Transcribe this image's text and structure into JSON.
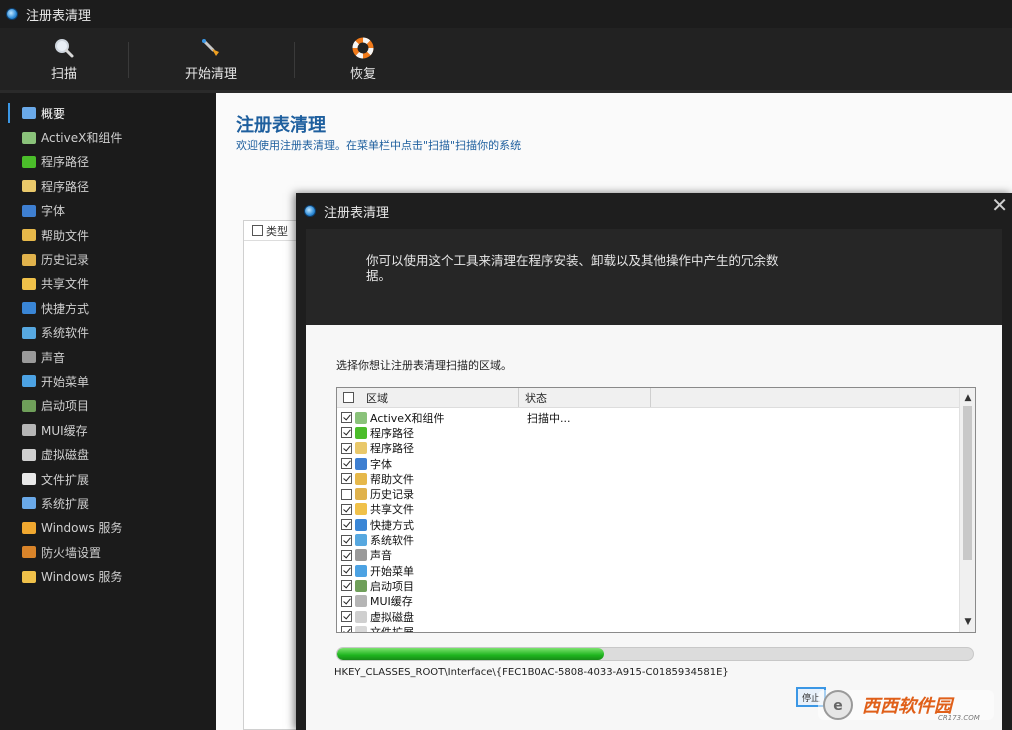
{
  "window": {
    "title": "注册表清理"
  },
  "toolbar": {
    "buttons": [
      {
        "label": "扫描",
        "icon": "magnifier-icon"
      },
      {
        "label": "开始清理",
        "icon": "broom-icon"
      },
      {
        "label": "恢复",
        "icon": "lifebuoy-icon"
      }
    ]
  },
  "sidebar": {
    "items": [
      {
        "label": "概要",
        "icon": "overview-icon",
        "color": "#6aa9e8"
      },
      {
        "label": "ActiveX和组件",
        "icon": "activex-icon",
        "color": "#8ac27a"
      },
      {
        "label": "程序路径",
        "icon": "program-path-icon",
        "color": "#4bbd2a"
      },
      {
        "label": "程序路径",
        "icon": "program-path-icon",
        "color": "#e9c86a"
      },
      {
        "label": "字体",
        "icon": "font-icon",
        "color": "#3e7fd1"
      },
      {
        "label": "帮助文件",
        "icon": "help-icon",
        "color": "#e6b84a"
      },
      {
        "label": "历史记录",
        "icon": "history-icon",
        "color": "#e0b24c"
      },
      {
        "label": "共享文件",
        "icon": "shared-folder-icon",
        "color": "#f0c14a"
      },
      {
        "label": "快捷方式",
        "icon": "shortcut-icon",
        "color": "#3a86d6"
      },
      {
        "label": "系统软件",
        "icon": "system-software-icon",
        "color": "#57a8e0"
      },
      {
        "label": "声音",
        "icon": "sound-icon",
        "color": "#9a9a9a"
      },
      {
        "label": "开始菜单",
        "icon": "start-menu-icon",
        "color": "#4ca2e3"
      },
      {
        "label": "启动项目",
        "icon": "startup-icon",
        "color": "#6f9f5a"
      },
      {
        "label": "MUI缓存",
        "icon": "mui-cache-icon",
        "color": "#b5b5b5"
      },
      {
        "label": "虚拟磁盘",
        "icon": "virtual-disk-icon",
        "color": "#cfcfcf"
      },
      {
        "label": "文件扩展",
        "icon": "file-extension-icon",
        "color": "#e8e8e8"
      },
      {
        "label": "系统扩展",
        "icon": "system-extension-icon",
        "color": "#6aa9e8"
      },
      {
        "label": "Windows 服务",
        "icon": "windows-service-icon",
        "color": "#f0a830"
      },
      {
        "label": "防火墙设置",
        "icon": "firewall-icon",
        "color": "#d9842a"
      },
      {
        "label": "Windows 服务",
        "icon": "windows-service-icon",
        "color": "#f0c14a"
      }
    ]
  },
  "main": {
    "title": "注册表清理",
    "subtitle": "欢迎使用注册表清理。在菜单栏中点击\"扫描\"扫描你的系统",
    "table_header": "类型"
  },
  "dialog": {
    "title": "注册表清理",
    "intro": "你可以使用这个工具来清理在程序安装、卸载以及其他操作中产生的冗余数据。",
    "prompt": "选择你想让注册表清理扫描的区域。",
    "columns": {
      "area": "区域",
      "status": "状态"
    },
    "rows": [
      {
        "label": "ActiveX和组件",
        "checked": true,
        "status": "扫描中...",
        "color": "#8ac27a"
      },
      {
        "label": "程序路径",
        "checked": true,
        "status": "",
        "color": "#4bbd2a"
      },
      {
        "label": "程序路径",
        "checked": true,
        "status": "",
        "color": "#e9c86a"
      },
      {
        "label": "字体",
        "checked": true,
        "status": "",
        "color": "#3e7fd1"
      },
      {
        "label": "帮助文件",
        "checked": true,
        "status": "",
        "color": "#e6b84a"
      },
      {
        "label": "历史记录",
        "checked": false,
        "status": "",
        "color": "#e0b24c"
      },
      {
        "label": "共享文件",
        "checked": true,
        "status": "",
        "color": "#f0c14a"
      },
      {
        "label": "快捷方式",
        "checked": true,
        "status": "",
        "color": "#3a86d6"
      },
      {
        "label": "系统软件",
        "checked": true,
        "status": "",
        "color": "#57a8e0"
      },
      {
        "label": "声音",
        "checked": true,
        "status": "",
        "color": "#9a9a9a"
      },
      {
        "label": "开始菜单",
        "checked": true,
        "status": "",
        "color": "#4ca2e3"
      },
      {
        "label": "启动项目",
        "checked": true,
        "status": "",
        "color": "#6f9f5a"
      },
      {
        "label": "MUI缓存",
        "checked": true,
        "status": "",
        "color": "#b5b5b5"
      },
      {
        "label": "虚拟磁盘",
        "checked": true,
        "status": "",
        "color": "#cfcfcf"
      },
      {
        "label": "文件扩展",
        "checked": true,
        "status": "",
        "color": "#d8d8d8"
      }
    ],
    "progress": 0.42,
    "registry_path": "HKEY_CLASSES_ROOT\\Interface\\{FEC1B0AC-5808-4033-A915-C0185934581E}",
    "stop_label": "停止"
  },
  "watermark": {
    "text": "西西软件园",
    "sub": "CR173.COM"
  }
}
